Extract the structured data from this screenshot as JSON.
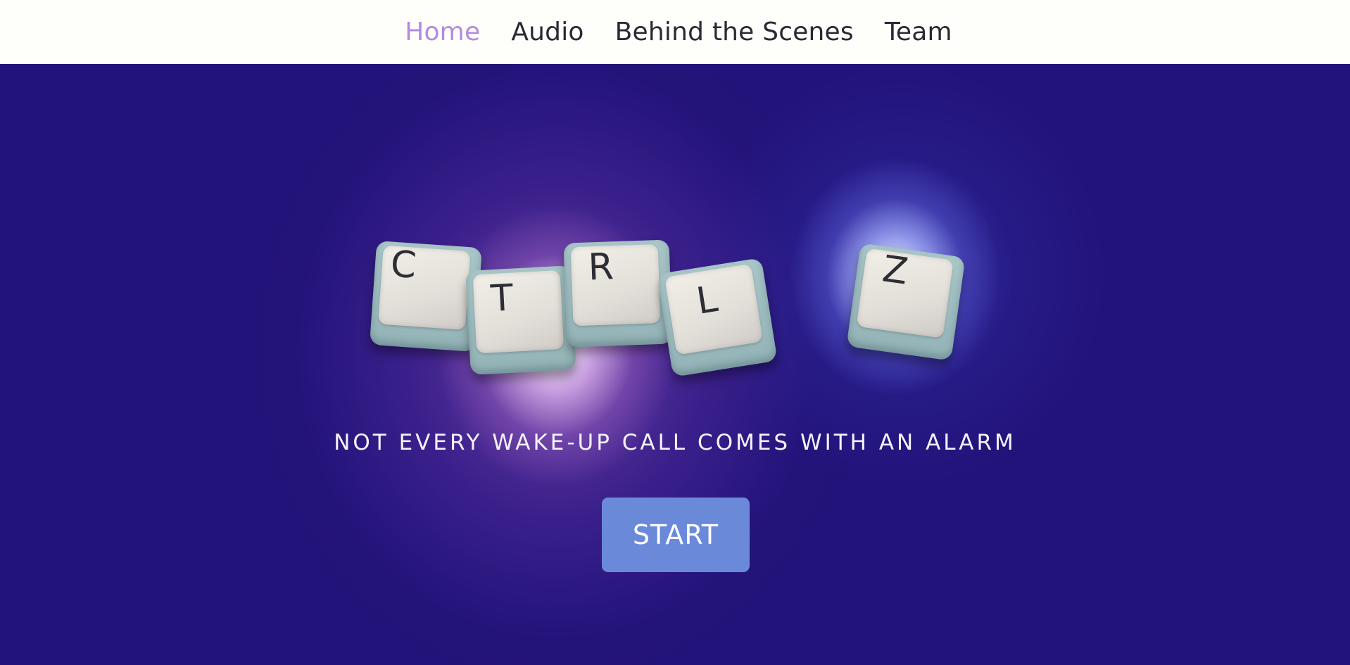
{
  "nav": {
    "items": [
      {
        "label": "Home",
        "active": true
      },
      {
        "label": "Audio",
        "active": false
      },
      {
        "label": "Behind the Scenes",
        "active": false
      },
      {
        "label": "Team",
        "active": false
      }
    ]
  },
  "hero": {
    "keys": [
      "C",
      "T",
      "R",
      "L",
      "Z"
    ],
    "tagline": "NOT EVERY WAKE-UP CALL COMES WITH AN ALARM",
    "start_label": "START"
  },
  "colors": {
    "nav_background": "#fefefb",
    "nav_text": "#2a2a33",
    "nav_active": "#b48be0",
    "hero_background": "#22137a",
    "button_background": "#6a8ad9",
    "button_text": "#ffffff"
  }
}
